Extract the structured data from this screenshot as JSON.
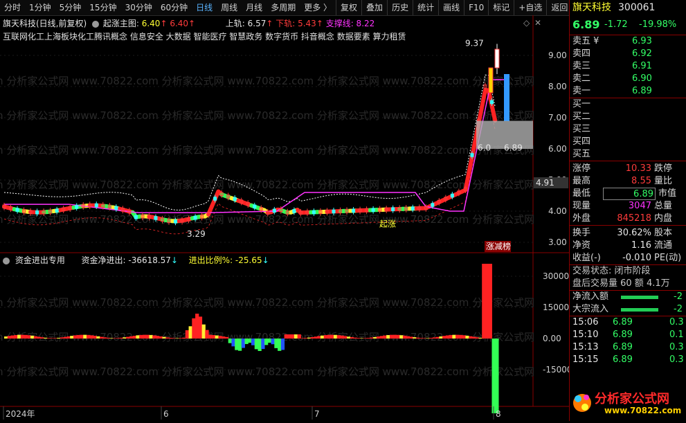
{
  "toolbar": {
    "periods": [
      "分时",
      "1分钟",
      "5分钟",
      "15分钟",
      "30分钟",
      "60分钟",
      "日线",
      "周线",
      "月线",
      "多周期",
      "更多 〉"
    ],
    "active_period": "日线",
    "actions": [
      "复权",
      "叠加",
      "历史",
      "统计",
      "画线",
      "F10",
      "标记",
      "+自选",
      "返回"
    ]
  },
  "main": {
    "stock_label": "旗天科技(日线,前复权)",
    "indicator_name": "起涨主图",
    "indicator_v1": "6.40",
    "indicator_v2": "6.40",
    "upper_label": "上轨: 6.57",
    "lower_label": "下轨: 5.43",
    "support_label": "支撑线: 8.22",
    "concepts": "互联网化工上海板块化工腾讯概念 信息安全 大数据 智能医疗 智慧政务 数字货币 抖音概念 数据要素 算力租赁",
    "price_axis": [
      "9.00",
      "8.00",
      "7.00",
      "6.00",
      "5.00",
      "4.00",
      "3.00"
    ],
    "current_price_tag": "4.91",
    "high_label": "9.37",
    "low_label": "3.29",
    "mark_label": "6.89",
    "mark_left": "6.0",
    "rise_label": "起涨",
    "badge": "涨减榜",
    "watermark": "m 分析家公式网 www.70822.com 分析家公式网 www.70822.com 分析家公式网 www.70822.com 分析家公式网"
  },
  "sub": {
    "name": "资金进出专用",
    "net_label": "资金净进出: -36618.57",
    "ratio_label": "进出比例%: -25.65",
    "axis": [
      "30000",
      "15000",
      "0.00",
      "-15000"
    ]
  },
  "xaxis": {
    "labels": [
      "2024年",
      "6",
      "7",
      "8"
    ]
  },
  "quote": {
    "name": "旗天科技",
    "code": "300061",
    "price": "6.89",
    "change": "-1.72",
    "pct": "-19.98%",
    "asks": [
      {
        "label": "卖五 ¥",
        "price": "6.93"
      },
      {
        "label": "卖四",
        "price": "6.92"
      },
      {
        "label": "卖三",
        "price": "6.91"
      },
      {
        "label": "卖二",
        "price": "6.90"
      },
      {
        "label": "卖一",
        "price": "6.89"
      }
    ],
    "bids": [
      {
        "label": "买一"
      },
      {
        "label": "买二"
      },
      {
        "label": "买三"
      },
      {
        "label": "买四"
      },
      {
        "label": "买五"
      }
    ],
    "stats": [
      {
        "l1": "涨停",
        "v1": "10.33",
        "l2": "跌停"
      },
      {
        "l1": "最高",
        "v1": "8.55",
        "l2": "量比"
      },
      {
        "l1": "最低",
        "v1": "6.89",
        "l2": "市值"
      },
      {
        "l1": "现量",
        "v1": "3047",
        "l2": "总量"
      },
      {
        "l1": "外盘",
        "v1": "845218",
        "l2": "内盘"
      }
    ],
    "turnover": {
      "l1": "换手",
      "v1": "30.62%",
      "l2": "股本"
    },
    "net_asset": {
      "l1": "净资",
      "v1": "1.16",
      "l2": "流通"
    },
    "profit": {
      "l1": "收益(-)",
      "v1": "-0.010",
      "l2": "PE(动)"
    },
    "status": "交易状态: 闭市阶段",
    "after": "盘后交易量 60 额 4.1万",
    "flows": [
      {
        "label": "净流入额",
        "value": "-2"
      },
      {
        "label": "大宗流入",
        "value": "-2"
      }
    ],
    "ticks": [
      {
        "time": "15:06",
        "price": "6.89",
        "vol": "0.3"
      },
      {
        "time": "15:10",
        "price": "6.89",
        "vol": "0.1"
      },
      {
        "time": "15:13",
        "price": "6.89",
        "vol": "0.3"
      },
      {
        "time": "15:15",
        "price": "6.89",
        "vol": "0.3"
      }
    ],
    "logo_text": "分析家公式网",
    "logo_url": "www.70822.com"
  },
  "colors": {
    "up": "#ff3b3b",
    "down": "#33ff66",
    "bg": "#000000",
    "accent": "#ff33ff"
  }
}
